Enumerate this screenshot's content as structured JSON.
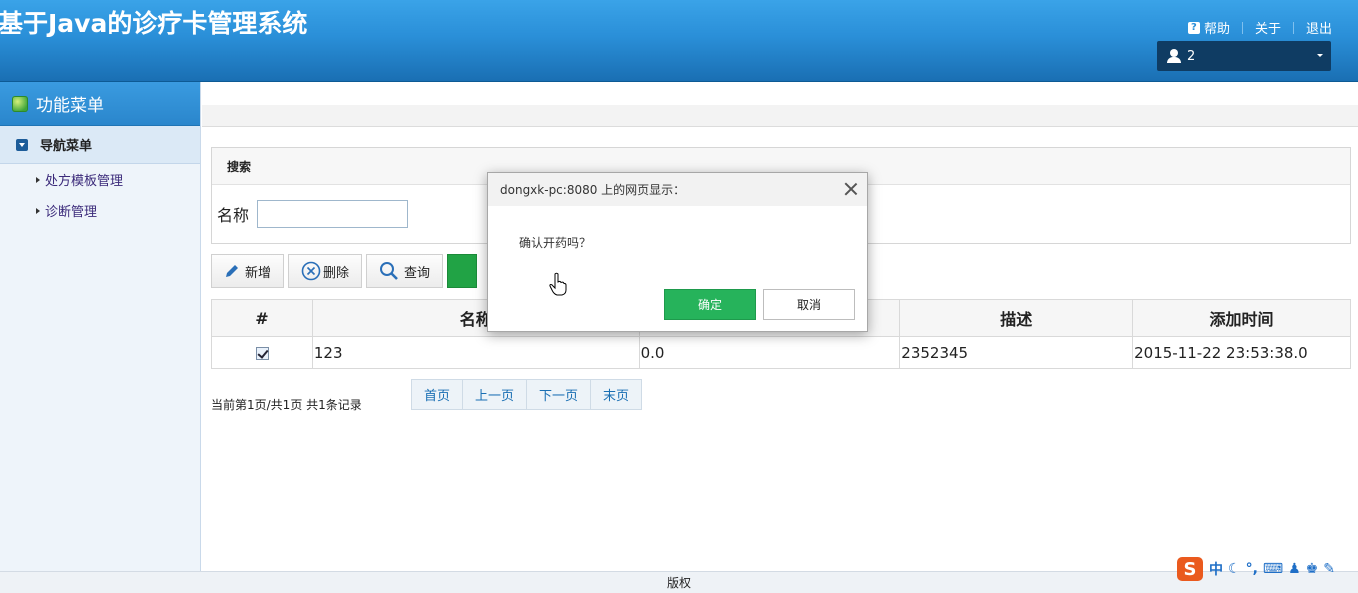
{
  "header": {
    "title": "基于Java的诊疗卡管理系统",
    "links": {
      "help": "帮助",
      "about": "关于",
      "logout": "退出"
    },
    "user": "2"
  },
  "sidebar": {
    "menu_title": "功能菜单",
    "nav_title": "导航菜单",
    "items": [
      {
        "label": "处方模板管理"
      },
      {
        "label": "诊断管理"
      }
    ]
  },
  "search": {
    "title": "搜索",
    "name_label": "名称",
    "name_value": ""
  },
  "toolbar": {
    "add": "新增",
    "delete": "删除",
    "query": "查询"
  },
  "table": {
    "headers": [
      "#",
      "名称",
      "",
      "描述",
      "添加时间"
    ],
    "rows": [
      {
        "checked": true,
        "name": "123",
        "price": "0.0",
        "desc": "2352345",
        "time": "2015-11-22 23:53:38.0"
      }
    ]
  },
  "pager": {
    "info": "当前第1页/共1页  共1条记录",
    "first": "首页",
    "prev": "上一页",
    "next": "下一页",
    "last": "末页"
  },
  "footer": {
    "text": "版权"
  },
  "dialog": {
    "title": "dongxk-pc:8080 上的网页显示：",
    "message": "确认开药吗？",
    "ok": "确定",
    "cancel": "取消"
  },
  "ime": {
    "lang": "中"
  },
  "colors": {
    "header_blue": "#2a8fd8",
    "ok_green": "#26b35b",
    "user_box": "#0f3c63"
  }
}
